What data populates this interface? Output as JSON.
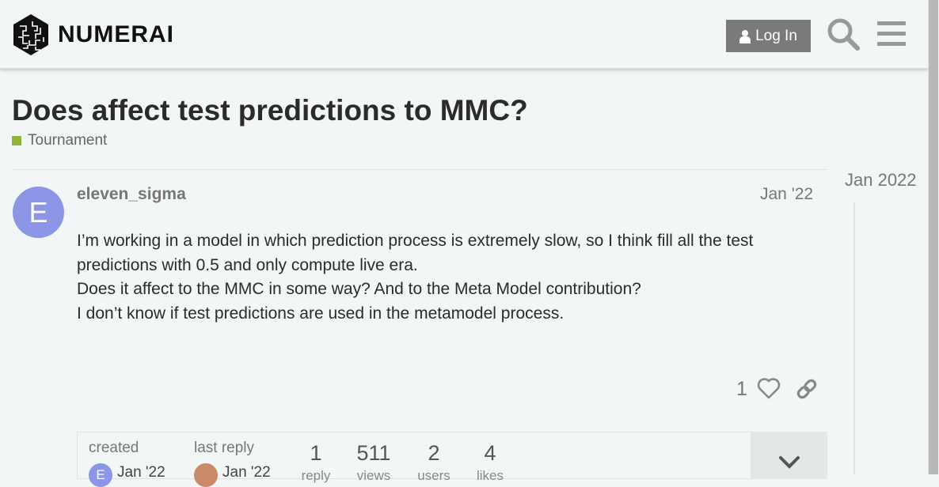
{
  "header": {
    "brand": "NUMERAI",
    "login_label": "Log In"
  },
  "topic": {
    "title": "Does affect test predictions to MMC?",
    "category": "Tournament",
    "category_color": "#91b53a"
  },
  "timeline": {
    "date": "Jan 2022"
  },
  "post": {
    "avatar_letter": "E",
    "avatar_color": "#8d95e6",
    "username": "eleven_sigma",
    "date": "Jan '22",
    "paragraphs": [
      "I’m working in a model in which prediction process is extremely slow, so I think fill all the test predictions with 0.5 and only compute live era.",
      "Does it affect to the MMC in some way? And to the Meta Model contribution?",
      "I don’t know if test predictions are used in the metamodel process."
    ],
    "like_count": "1"
  },
  "topic_map": {
    "created_label": "created",
    "created_date": "Jan '22",
    "last_reply_label": "last reply",
    "last_reply_date": "Jan '22",
    "stats": [
      {
        "num": "1",
        "label": "reply"
      },
      {
        "num": "511",
        "label": "views"
      },
      {
        "num": "2",
        "label": "users"
      },
      {
        "num": "4",
        "label": "likes"
      }
    ]
  }
}
